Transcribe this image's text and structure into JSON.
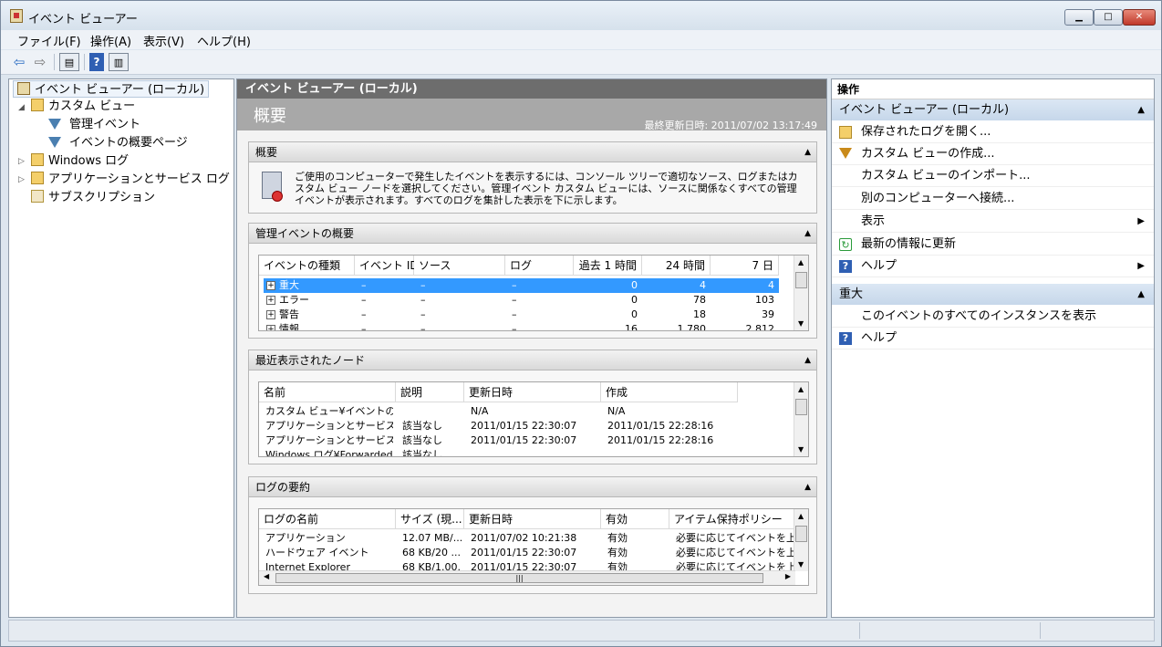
{
  "window": {
    "title": "イベント ビューアー"
  },
  "menu": [
    "ファイル(F)",
    "操作(A)",
    "表示(V)",
    "ヘルプ(H)"
  ],
  "tree": {
    "root": "イベント ビューアー (ローカル)",
    "custom_views": "カスタム ビュー",
    "admin_events": "管理イベント",
    "summary_page": "イベントの概要ページ",
    "windows_logs": "Windows ログ",
    "app_service_logs": "アプリケーションとサービス ログ",
    "subscriptions": "サブスクリプション"
  },
  "center": {
    "header": "イベント ビューアー (ローカル)",
    "overview_title": "概要",
    "last_updated": "最終更新日時: 2011/07/02 13:17:49",
    "summary_section": "概要",
    "summary_text": "ご使用のコンピューターで発生したイベントを表示するには、コンソール ツリーで適切なソース、ログまたはカスタム ビュー ノードを選択してください。管理イベント カスタム ビューには、ソースに関係なくすべての管理イベントが表示されます。すべてのログを集計した表示を下に示します。",
    "admin_section": "管理イベントの概要",
    "admin_cols": [
      "イベントの種類",
      "イベント ID",
      "ソース",
      "ログ",
      "過去 1 時間",
      "24 時間",
      "7 日"
    ],
    "admin_rows": [
      {
        "type": "重大",
        "id": "–",
        "source": "–",
        "log": "–",
        "h1": "0",
        "h24": "4",
        "d7": "4"
      },
      {
        "type": "エラー",
        "id": "–",
        "source": "–",
        "log": "–",
        "h1": "0",
        "h24": "78",
        "d7": "103"
      },
      {
        "type": "警告",
        "id": "–",
        "source": "–",
        "log": "–",
        "h1": "0",
        "h24": "18",
        "d7": "39"
      },
      {
        "type": "情報",
        "id": "–",
        "source": "–",
        "log": "–",
        "h1": "16",
        "h24": "1,780",
        "d7": "2,812"
      }
    ],
    "recent_section": "最近表示されたノード",
    "recent_cols": [
      "名前",
      "説明",
      "更新日時",
      "作成"
    ],
    "recent_rows": [
      {
        "name": "カスタム ビュー¥イベントの概...",
        "desc": "",
        "updated": "N/A",
        "created": "N/A"
      },
      {
        "name": "アプリケーションとサービス ログ...",
        "desc": "該当なし",
        "updated": "2011/01/15 22:30:07",
        "created": "2011/01/15 22:28:16"
      },
      {
        "name": "アプリケーションとサービス ログ...",
        "desc": "該当なし",
        "updated": "2011/01/15 22:30:07",
        "created": "2011/01/15 22:28:16"
      },
      {
        "name": "Windows ログ¥Forwarded E...",
        "desc": "該当なし",
        "updated": "",
        "created": ""
      }
    ],
    "logs_section": "ログの要約",
    "logs_cols": [
      "ログの名前",
      "サイズ (現...",
      "更新日時",
      "有効",
      "アイテム保持ポリシー"
    ],
    "logs_rows": [
      {
        "name": "アプリケーション",
        "size": "12.07 MB/...",
        "updated": "2011/07/02 10:21:38",
        "enabled": "有効",
        "policy": "必要に応じてイベントを上書"
      },
      {
        "name": "ハードウェア イベント",
        "size": "68 KB/20 ...",
        "updated": "2011/01/15 22:30:07",
        "enabled": "有効",
        "policy": "必要に応じてイベントを上書"
      },
      {
        "name": "Internet Explorer",
        "size": "68 KB/1.00...",
        "updated": "2011/01/15 22:30:07",
        "enabled": "有効",
        "policy": "必要に応じてイベントを上書"
      }
    ]
  },
  "actions": {
    "title": "操作",
    "section1": "イベント ビューアー (ローカル)",
    "items1": [
      "保存されたログを開く...",
      "カスタム ビューの作成...",
      "カスタム ビューのインポート...",
      "別のコンピューターへ接続...",
      "表示",
      "最新の情報に更新",
      "ヘルプ"
    ],
    "section2": "重大",
    "items2": [
      "このイベントのすべてのインスタンスを表示",
      "ヘルプ"
    ]
  },
  "colors": {
    "selection": "#3399ff",
    "center_header": "#6d6d6d",
    "section_bar": "#c6d7ea"
  }
}
